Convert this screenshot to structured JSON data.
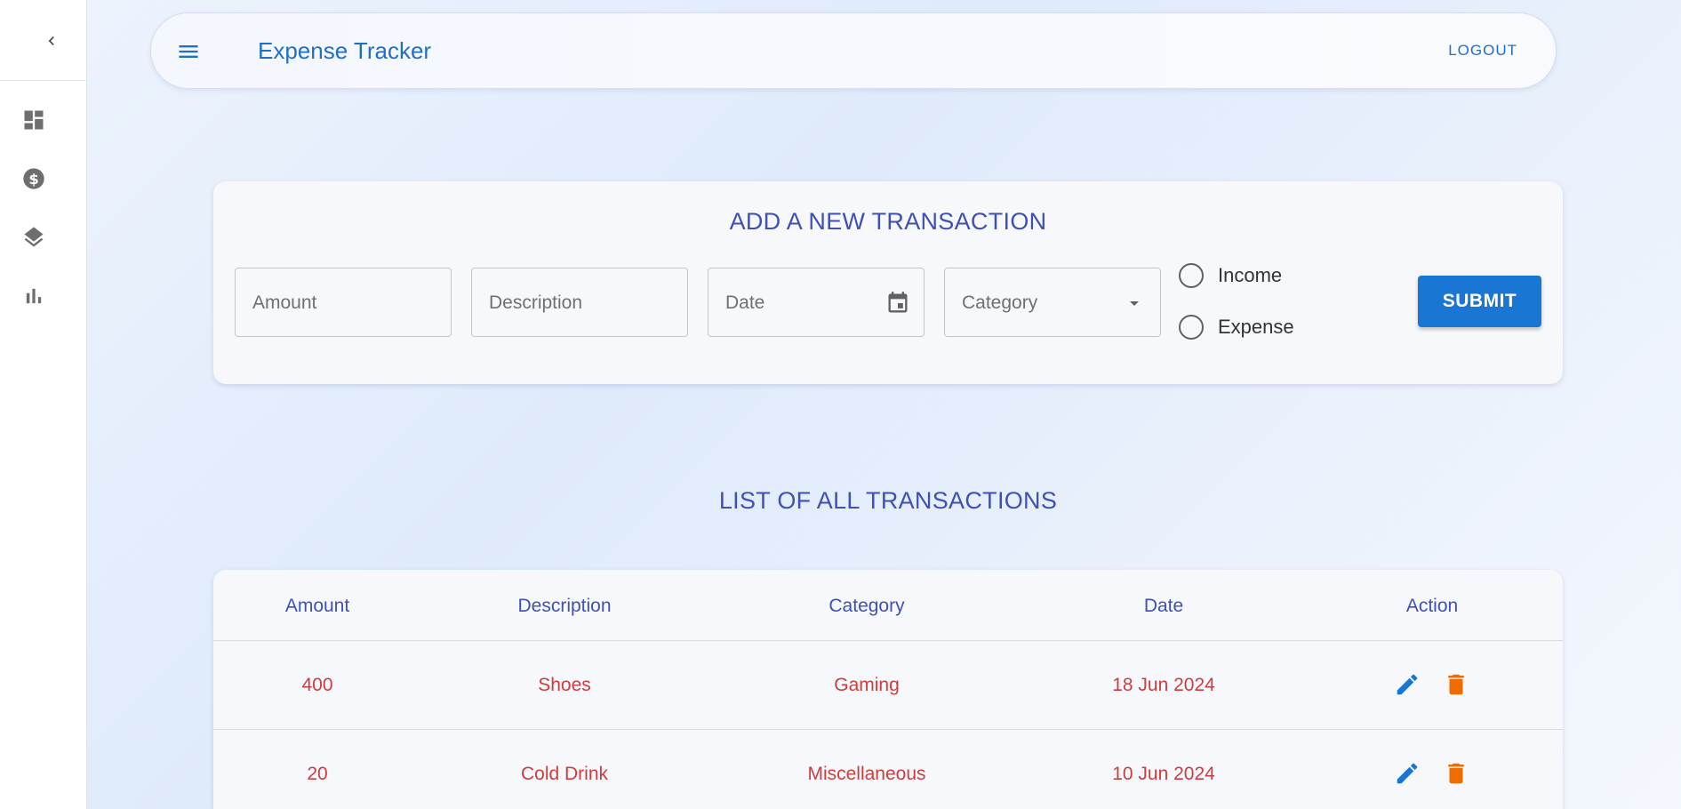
{
  "sidebar": {
    "collapse_icon": "chevron-left-icon",
    "items": [
      {
        "icon": "dashboard-icon"
      },
      {
        "icon": "dollar-icon"
      },
      {
        "icon": "layers-icon"
      },
      {
        "icon": "bar-chart-icon"
      }
    ]
  },
  "header": {
    "menu_icon": "hamburger-menu-icon",
    "title": "Expense Tracker",
    "logout_label": "LOGOUT"
  },
  "form": {
    "title": "ADD A NEW TRANSACTION",
    "amount_placeholder": "Amount",
    "description_placeholder": "Description",
    "date_placeholder": "Date",
    "category_placeholder": "Category",
    "radio_income": "Income",
    "radio_expense": "Expense",
    "submit_label": "SUBMIT"
  },
  "list": {
    "title": "LIST OF ALL TRANSACTIONS",
    "columns": [
      "Amount",
      "Description",
      "Category",
      "Date",
      "Action"
    ],
    "rows": [
      {
        "amount": "400",
        "description": "Shoes",
        "category": "Gaming",
        "date": "18 Jun 2024"
      },
      {
        "amount": "20",
        "description": "Cold Drink",
        "category": "Miscellaneous",
        "date": "10 Jun 2024"
      }
    ]
  },
  "colors": {
    "primary": "#1976d2",
    "heading": "#3f51b5",
    "expense_text": "#d03c3c",
    "delete_icon": "#ef6c00"
  }
}
